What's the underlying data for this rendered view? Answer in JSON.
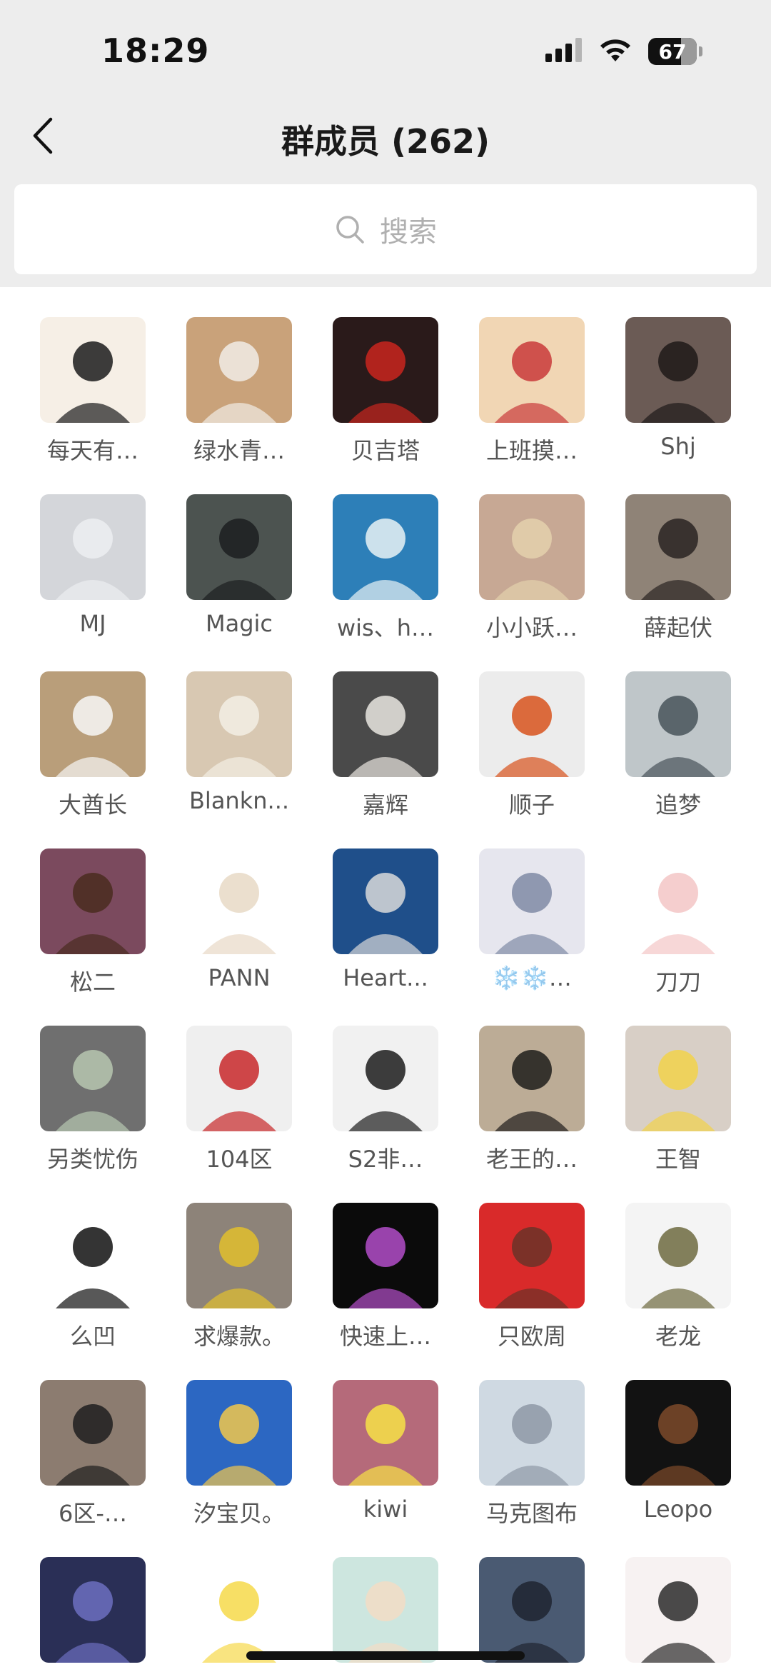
{
  "status": {
    "time": "18:29",
    "battery": "67"
  },
  "header": {
    "title": "群成员 (262)"
  },
  "search": {
    "placeholder": "搜索"
  },
  "members": [
    {
      "name": "每天有…",
      "bg": "#f6efe6",
      "fg": "#1b1b1b"
    },
    {
      "name": "绿水青…",
      "bg": "#c9a27a",
      "fg": "#f1ece6"
    },
    {
      "name": "贝吉塔",
      "bg": "#2a1a1a",
      "fg": "#c9261f"
    },
    {
      "name": "上班摸…",
      "bg": "#f1d6b4",
      "fg": "#c93a3a"
    },
    {
      "name": "Shj",
      "bg": "#6b5b55",
      "fg": "#1e1a19"
    },
    {
      "name": "MJ",
      "bg": "#d4d6da",
      "fg": "#eceef1"
    },
    {
      "name": "Magic",
      "bg": "#4c5350",
      "fg": "#1c1f20"
    },
    {
      "name": "wis、h…",
      "bg": "#2d7fb8",
      "fg": "#e9f2f5"
    },
    {
      "name": "小小跃…",
      "bg": "#c7a894",
      "fg": "#e4d1ad"
    },
    {
      "name": "薛起伏",
      "bg": "#8f8377",
      "fg": "#2a2422"
    },
    {
      "name": "大酋长",
      "bg": "#b99e7a",
      "fg": "#f7f7f7"
    },
    {
      "name": "Blankn...",
      "bg": "#d8c8b2",
      "fg": "#f3eee4"
    },
    {
      "name": "嘉辉",
      "bg": "#4a4a4a",
      "fg": "#e9e6e0"
    },
    {
      "name": "顺子",
      "bg": "#ececec",
      "fg": "#d8531d"
    },
    {
      "name": "追梦",
      "bg": "#bfc6c9",
      "fg": "#48535a"
    },
    {
      "name": "松二",
      "bg": "#7b4a5e",
      "fg": "#4a2b1f"
    },
    {
      "name": "PANN",
      "bg": "#ffffff",
      "fg": "#e8d9c6"
    },
    {
      "name": "Heart...",
      "bg": "#1f4f8a",
      "fg": "#d9d9d9"
    },
    {
      "name": "❄️❄️…",
      "bg": "#e6e6ee",
      "fg": "#7f8aa5"
    },
    {
      "name": "刀刀",
      "bg": "#ffffff",
      "fg": "#f3c6c6"
    },
    {
      "name": "另类忧伤",
      "bg": "#6f6f6f",
      "fg": "#b7c7b0"
    },
    {
      "name": "104区",
      "bg": "#efefef",
      "fg": "#c8282a"
    },
    {
      "name": "S2非…",
      "bg": "#f1f1f1",
      "fg": "#1c1c1c"
    },
    {
      "name": "老王的…",
      "bg": "#bcac96",
      "fg": "#1f1d1b"
    },
    {
      "name": "王智",
      "bg": "#d8cfc6",
      "fg": "#f2d24a"
    },
    {
      "name": "么凹",
      "bg": "#ffffff",
      "fg": "#111111"
    },
    {
      "name": "求爆款。",
      "bg": "#8d8379",
      "fg": "#e2c02d"
    },
    {
      "name": "快速上…",
      "bg": "#0b0b0b",
      "fg": "#b34ec9"
    },
    {
      "name": "只欧周",
      "bg": "#d92a2a",
      "fg": "#6a3228"
    },
    {
      "name": "老龙",
      "bg": "#f4f4f4",
      "fg": "#6d6a3f"
    },
    {
      "name": "6区-…",
      "bg": "#8c7c70",
      "fg": "#1e1e1e"
    },
    {
      "name": "汐宝贝。",
      "bg": "#2c67c2",
      "fg": "#f2c84b"
    },
    {
      "name": "kiwi",
      "bg": "#b56a7a",
      "fg": "#f7e246"
    },
    {
      "name": "马克图布",
      "bg": "#cfd9e2",
      "fg": "#8e98a6"
    },
    {
      "name": "Leopo",
      "bg": "#121212",
      "fg": "#7d4a2a"
    },
    {
      "name": "",
      "bg": "#2a2f56",
      "fg": "#6c6ec0"
    },
    {
      "name": "",
      "bg": "#ffffff",
      "fg": "#f6d94a"
    },
    {
      "name": "",
      "bg": "#cde6df",
      "fg": "#f2dcc5"
    },
    {
      "name": "",
      "bg": "#4a5a72",
      "fg": "#1f2430"
    },
    {
      "name": "",
      "bg": "#f7f2f2",
      "fg": "#2b2b2b"
    }
  ]
}
